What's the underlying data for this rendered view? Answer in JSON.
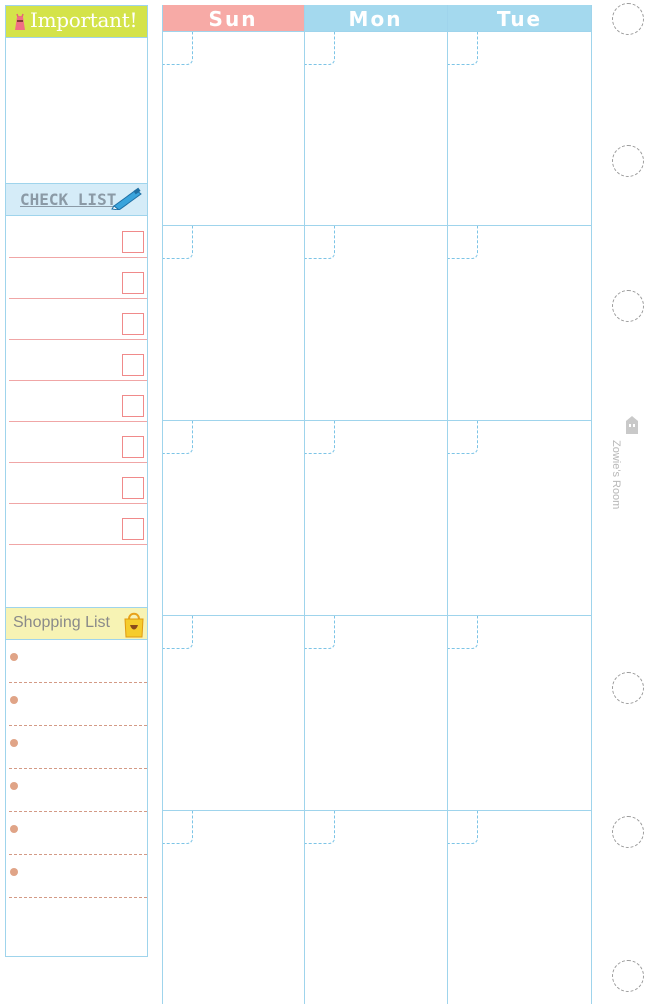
{
  "important": {
    "title": "Important!"
  },
  "checklist": {
    "title": "CHECK LIST",
    "box_count": 8
  },
  "shopping": {
    "title": "Shopping List",
    "item_count": 6
  },
  "calendar": {
    "days": [
      {
        "label": "Sun",
        "color": "#f7aaa6"
      },
      {
        "label": "Mon",
        "color": "#a4d9ee"
      },
      {
        "label": "Tue",
        "color": "#a4d9ee"
      }
    ],
    "week_rows": 5
  },
  "brand": {
    "text": "Zowie's Room"
  },
  "colors": {
    "important_header": "#d4e34a",
    "checklist_header": "#d5ecf8",
    "shopping_header": "#f7f3b4",
    "grid_line": "#9fd4ec",
    "check_line": "#f0a6a6"
  }
}
